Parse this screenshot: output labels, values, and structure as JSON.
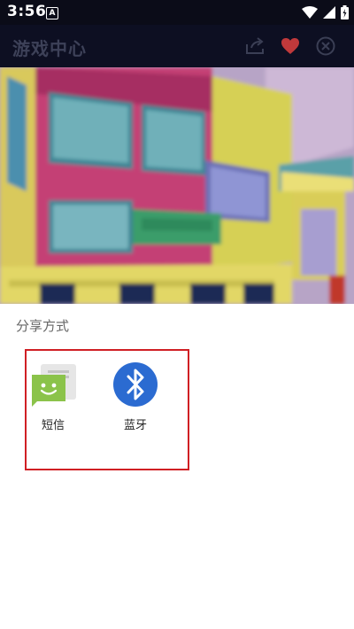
{
  "status_bar": {
    "time": "3:56",
    "notification_badge": "A"
  },
  "title_bar": {
    "title": "游戏中心",
    "icons": [
      "share-icon",
      "heart-icon",
      "close-icon"
    ],
    "heart_color": "#c0393b"
  },
  "share_sheet": {
    "title": "分享方式",
    "apps": [
      {
        "label": "短信",
        "icon": "messaging-icon",
        "color": "#8bc34a"
      },
      {
        "label": "蓝牙",
        "icon": "bluetooth-icon",
        "color": "#2b6bd1"
      }
    ],
    "highlight_color": "#d01f24"
  }
}
